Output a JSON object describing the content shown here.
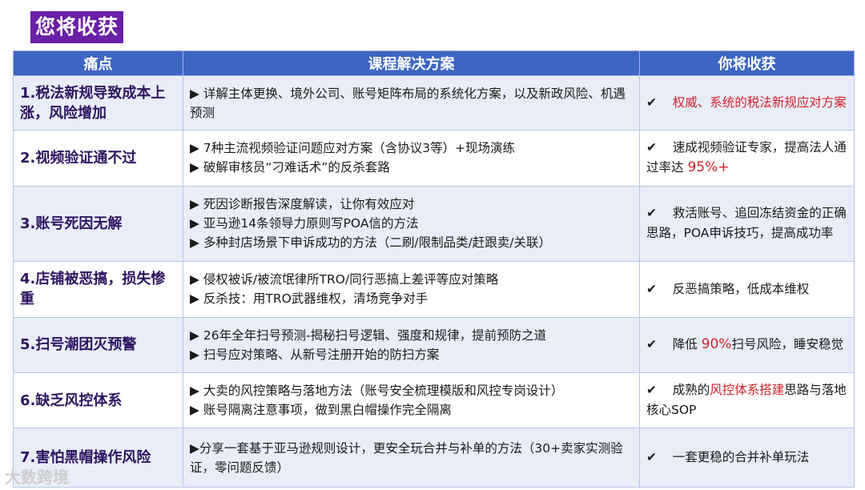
{
  "title": "您将收获",
  "header": {
    "col1": "痛点",
    "col2": "课程解决方案",
    "col3": "你将收获"
  },
  "rows": [
    {
      "pain": "1.税法新规导致成本上涨，风险增加",
      "solutions": [
        "▶ 详解主体更换、境外公司、账号矩阵布局的系统化方案，以及新政风险、机遇预测"
      ],
      "gain_check": "✔",
      "gain_pre": "",
      "gain_red": "权威、系统的税法新规应对方案",
      "gain_post": ""
    },
    {
      "pain": "2.视频验证通不过",
      "solutions": [
        "▶ 7种主流视频验证问题应对方案（含协议3等）+现场演练",
        "▶ 破解审核员“刁难话术”的反杀套路"
      ],
      "gain_check": "✔",
      "gain_pre": "速成视频验证专家，提高法人通过率达 ",
      "gain_red": "95%+",
      "gain_post": ""
    },
    {
      "pain": "3.账号死因无解",
      "solutions": [
        "▶ 死因诊断报告深度解读，让你有效应对",
        "▶ 亚马逊14条领导力原则写POA信的方法",
        "▶ 多种封店场景下申诉成功的方法（二刷/限制品类/赶跟卖/关联）"
      ],
      "gain_check": "✔",
      "gain_pre": "救活账号、追回冻结资金的正确思路，POA申诉技巧，提高成功率",
      "gain_red": "",
      "gain_post": ""
    },
    {
      "pain": "4.店铺被恶搞，损失惨重",
      "solutions": [
        "▶ 侵权被诉/被流氓律所TRO/同行恶搞上差评等应对策略",
        "▶ 反杀技：用TRO武器维权，清场竞争对手"
      ],
      "gain_check": "✔",
      "gain_pre": "反恶搞策略，低成本维权",
      "gain_red": "",
      "gain_post": ""
    },
    {
      "pain": "5.扫号潮团灭预警",
      "solutions": [
        "▶ 26年全年扫号预测-揭秘扫号逻辑、强度和规律，提前预防之道",
        "▶ 扫号应对策略、从新号注册开始的防扫方案"
      ],
      "gain_check": "✔",
      "gain_pre": "降低 ",
      "gain_red": "90%",
      "gain_post": "扫号风险，睡安稳觉"
    },
    {
      "pain": "6.缺乏风控体系",
      "solutions": [
        "▶ 大卖的风控策略与落地方法（账号安全梳理模版和风控专岗设计）",
        "▶ 账号隔离注意事项，做到黑白帽操作完全隔离"
      ],
      "gain_check": "✔",
      "gain_pre": "成熟的",
      "gain_red": "风控体系搭建",
      "gain_post": "思路与落地核心SOP"
    },
    {
      "pain": "7.害怕黑帽操作风险",
      "solutions": [
        "▶分享一套基于亚马逊规则设计，更安全玩合并与补单的方法（30+卖家实测验证，零问题反馈）"
      ],
      "gain_check": "✔",
      "gain_pre": "一套更稳的合并补单玩法",
      "gain_red": "",
      "gain_post": ""
    }
  ],
  "watermark": "大数跨境"
}
